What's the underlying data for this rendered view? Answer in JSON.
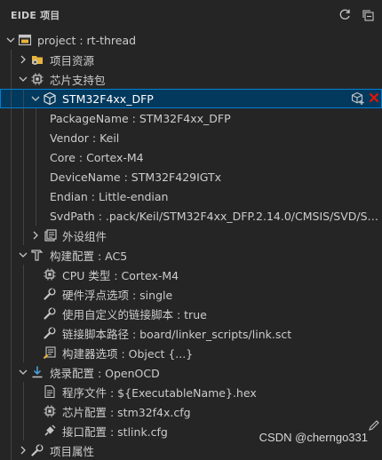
{
  "header": {
    "title": "EIDE 项目",
    "refresh_icon": "refresh-icon",
    "collapse_icon": "collapse-all-icon"
  },
  "tree": [
    {
      "id": "project",
      "depth": 1,
      "twisty": "down",
      "icon": "project-icon",
      "label": "project : rt-thread"
    },
    {
      "id": "project-resources",
      "depth": 2,
      "twisty": "right",
      "icon": "resources-icon",
      "label": "项目资源"
    },
    {
      "id": "chip-support",
      "depth": 2,
      "twisty": "down",
      "icon": "chip-icon",
      "label": "芯片支持包"
    },
    {
      "id": "pack",
      "depth": 3,
      "twisty": "down",
      "icon": "package-icon",
      "label": "STM32F4xx_DFP",
      "selected": true
    },
    {
      "id": "pack-name",
      "depth": 4,
      "twisty": "none",
      "icon": "none",
      "label": "PackageName : STM32F4xx_DFP"
    },
    {
      "id": "pack-vendor",
      "depth": 4,
      "twisty": "none",
      "icon": "none",
      "label": "Vendor : Keil"
    },
    {
      "id": "pack-core",
      "depth": 4,
      "twisty": "none",
      "icon": "none",
      "label": "Core : Cortex-M4"
    },
    {
      "id": "pack-device",
      "depth": 4,
      "twisty": "none",
      "icon": "none",
      "label": "DeviceName : STM32F429IGTx"
    },
    {
      "id": "pack-endian",
      "depth": 4,
      "twisty": "none",
      "icon": "none",
      "label": "Endian : Little-endian"
    },
    {
      "id": "pack-svd",
      "depth": 4,
      "twisty": "none",
      "icon": "none",
      "label": "SvdPath : .pack/Keil/STM32F4xx_DFP.2.14.0/CMSIS/SVD/STM3..."
    },
    {
      "id": "peripherals",
      "depth": 3,
      "twisty": "right",
      "icon": "peripheral-icon",
      "label": "外设组件"
    },
    {
      "id": "build-config",
      "depth": 2,
      "twisty": "down",
      "icon": "hammer-icon",
      "label": "构建配置 : AC5"
    },
    {
      "id": "cpu-type",
      "depth": 3,
      "twisty": "none",
      "icon": "chip-icon",
      "label": "CPU 类型 : Cortex-M4"
    },
    {
      "id": "fpu",
      "depth": 3,
      "twisty": "none",
      "icon": "wrench-icon",
      "label": "硬件浮点选项 : single"
    },
    {
      "id": "custom-link",
      "depth": 3,
      "twisty": "none",
      "icon": "wrench-icon",
      "label": "使用自定义的链接脚本 : true"
    },
    {
      "id": "link-path",
      "depth": 3,
      "twisty": "none",
      "icon": "wrench-icon",
      "label": "链接脚本路径 : board/linker_scripts/link.sct"
    },
    {
      "id": "builder-options",
      "depth": 3,
      "twisty": "none",
      "icon": "builder-options-icon",
      "label": "构建器选项 : Object {...}"
    },
    {
      "id": "flash-config",
      "depth": 2,
      "twisty": "down",
      "icon": "download-icon",
      "label": "烧录配置 : OpenOCD"
    },
    {
      "id": "program-file",
      "depth": 3,
      "twisty": "none",
      "icon": "file-icon",
      "label": "程序文件 : ${ExecutableName}.hex"
    },
    {
      "id": "chip-config",
      "depth": 3,
      "twisty": "none",
      "icon": "chip-icon",
      "label": "芯片配置 : stm32f4x.cfg"
    },
    {
      "id": "interface-config",
      "depth": 3,
      "twisty": "none",
      "icon": "interface-icon",
      "label": "接口配置 : stlink.cfg"
    },
    {
      "id": "project-attributes",
      "depth": 2,
      "twisty": "right",
      "icon": "wrench-icon",
      "label": "项目属性"
    }
  ],
  "selected_row_actions": [
    "add-package-icon",
    "remove-icon"
  ],
  "watermark": "CSDN @cherngo331",
  "colors": {
    "background": "#252526",
    "selection": "#04395e",
    "selection_border": "#007fd4",
    "text": "#cccccc",
    "remove": "#e51400",
    "accent_yellow": "#e8b43a"
  }
}
